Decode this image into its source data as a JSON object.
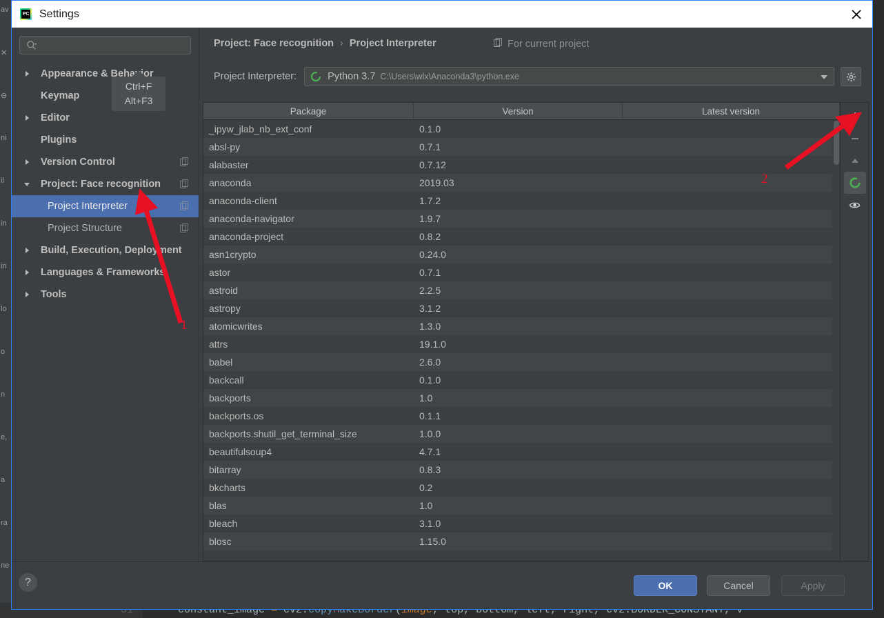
{
  "window": {
    "title": "Settings",
    "app_icon": "pycharm-logo-icon",
    "close_icon": "close-icon"
  },
  "sidebar": {
    "search": {
      "placeholder": "",
      "value": "",
      "icon": "search-icon"
    },
    "tooltip": {
      "line1": "Ctrl+F",
      "line2": "Alt+F3"
    },
    "items": [
      {
        "label": "Appearance & Behavior",
        "expandable": true,
        "expanded": false,
        "child": false,
        "badge": false
      },
      {
        "label": "Keymap",
        "expandable": false,
        "expanded": false,
        "child": false,
        "badge": false
      },
      {
        "label": "Editor",
        "expandable": true,
        "expanded": false,
        "child": false,
        "badge": false
      },
      {
        "label": "Plugins",
        "expandable": false,
        "expanded": false,
        "child": false,
        "badge": false
      },
      {
        "label": "Version Control",
        "expandable": true,
        "expanded": false,
        "child": false,
        "badge": true
      },
      {
        "label": "Project: Face recognition",
        "expandable": true,
        "expanded": true,
        "child": false,
        "badge": true
      },
      {
        "label": "Project Interpreter",
        "expandable": false,
        "expanded": false,
        "child": true,
        "badge": true,
        "selected": true
      },
      {
        "label": "Project Structure",
        "expandable": false,
        "expanded": false,
        "child": true,
        "badge": true
      },
      {
        "label": "Build, Execution, Deployment",
        "expandable": true,
        "expanded": false,
        "child": false,
        "badge": false
      },
      {
        "label": "Languages & Frameworks",
        "expandable": true,
        "expanded": false,
        "child": false,
        "badge": false
      },
      {
        "label": "Tools",
        "expandable": true,
        "expanded": false,
        "child": false,
        "badge": false
      }
    ]
  },
  "content": {
    "breadcrumb": {
      "parent": "Project: Face recognition",
      "separator": "›",
      "current": "Project Interpreter"
    },
    "scope_label": "For current project",
    "scope_icon": "copy-scope-icon",
    "interpreter": {
      "label": "Project Interpreter:",
      "icon": "python-env-icon",
      "name": "Python 3.7",
      "path": "C:\\Users\\wlx\\Anaconda3\\python.exe",
      "dropdown_icon": "chevron-down-icon",
      "settings_icon": "gear-icon"
    },
    "table": {
      "columns": [
        "Package",
        "Version",
        "Latest version"
      ],
      "rows": [
        {
          "package": "_ipyw_jlab_nb_ext_conf",
          "version": "0.1.0",
          "latest": ""
        },
        {
          "package": "absl-py",
          "version": "0.7.1",
          "latest": ""
        },
        {
          "package": "alabaster",
          "version": "0.7.12",
          "latest": ""
        },
        {
          "package": "anaconda",
          "version": "2019.03",
          "latest": ""
        },
        {
          "package": "anaconda-client",
          "version": "1.7.2",
          "latest": ""
        },
        {
          "package": "anaconda-navigator",
          "version": "1.9.7",
          "latest": ""
        },
        {
          "package": "anaconda-project",
          "version": "0.8.2",
          "latest": ""
        },
        {
          "package": "asn1crypto",
          "version": "0.24.0",
          "latest": ""
        },
        {
          "package": "astor",
          "version": "0.7.1",
          "latest": ""
        },
        {
          "package": "astroid",
          "version": "2.2.5",
          "latest": ""
        },
        {
          "package": "astropy",
          "version": "3.1.2",
          "latest": ""
        },
        {
          "package": "atomicwrites",
          "version": "1.3.0",
          "latest": ""
        },
        {
          "package": "attrs",
          "version": "19.1.0",
          "latest": ""
        },
        {
          "package": "babel",
          "version": "2.6.0",
          "latest": ""
        },
        {
          "package": "backcall",
          "version": "0.1.0",
          "latest": ""
        },
        {
          "package": "backports",
          "version": "1.0",
          "latest": ""
        },
        {
          "package": "backports.os",
          "version": "0.1.1",
          "latest": ""
        },
        {
          "package": "backports.shutil_get_terminal_size",
          "version": "1.0.0",
          "latest": ""
        },
        {
          "package": "beautifulsoup4",
          "version": "4.7.1",
          "latest": ""
        },
        {
          "package": "bitarray",
          "version": "0.8.3",
          "latest": ""
        },
        {
          "package": "bkcharts",
          "version": "0.2",
          "latest": ""
        },
        {
          "package": "blas",
          "version": "1.0",
          "latest": ""
        },
        {
          "package": "bleach",
          "version": "3.1.0",
          "latest": ""
        },
        {
          "package": "blosc",
          "version": "1.15.0",
          "latest": ""
        }
      ]
    },
    "toolbar": [
      {
        "icon": "plus-icon",
        "name": "install-package-button"
      },
      {
        "icon": "minus-icon",
        "name": "uninstall-package-button"
      },
      {
        "icon": "arrow-up-icon",
        "name": "upgrade-package-button"
      },
      {
        "icon": "python-env-icon",
        "name": "conda-env-button"
      },
      {
        "icon": "eye-icon",
        "name": "show-early-releases-button"
      }
    ]
  },
  "footer": {
    "help_label": "?",
    "ok_label": "OK",
    "cancel_label": "Cancel",
    "apply_label": "Apply"
  },
  "annotations": [
    {
      "number": "1",
      "target": "project-interpreter-sidebar-item"
    },
    {
      "number": "2",
      "target": "install-package-button"
    }
  ],
  "background_ide": {
    "code_line_number": "31",
    "code_text": "constant_image = cv2.copyMakeBorder(image, top, bottom, left, right, cv2.BORDER_CONSTANT, v",
    "left_strip_chars": [
      "av",
      "✕",
      "⊖",
      "ni",
      "il",
      "in",
      "in",
      "lo",
      "o",
      "n",
      "e,",
      "a",
      "ra",
      "ne"
    ]
  },
  "colors": {
    "accent": "#4b6eaf",
    "dialog_bg": "#3c3f41",
    "border": "#2d7ff9",
    "annotation": "#e81123",
    "row_even": "#414547",
    "row_odd": "#3c3f41"
  }
}
